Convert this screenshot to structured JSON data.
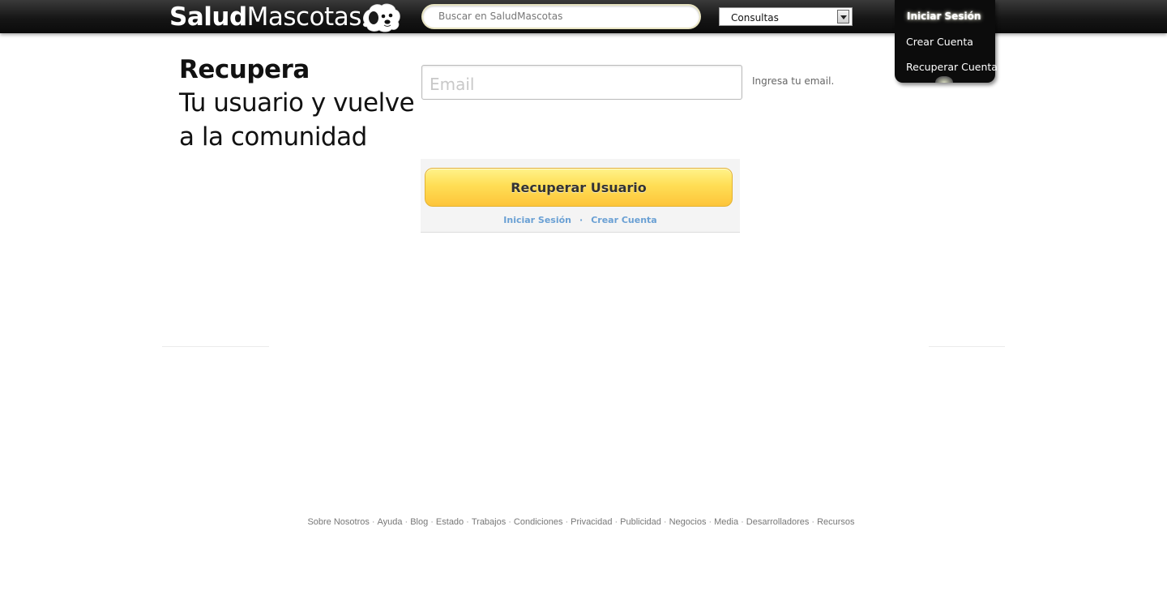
{
  "header": {
    "logo_bold": "Salud",
    "logo_light": "Mascotas",
    "search_placeholder": "Buscar en SaludMascotas",
    "category_select": "Consultas"
  },
  "menu": {
    "items": [
      "Iniciar Sesión",
      "Crear Cuenta",
      "Recuperar Cuenta"
    ],
    "active": "Iniciar Sesión"
  },
  "main": {
    "heading_main": "Recupera",
    "heading_sub_1": "Tu usuario y vuelve",
    "heading_sub_2": "a la comunidad",
    "email_placeholder": "Email",
    "email_hint": "Ingresa tu email.",
    "submit_label": "Recuperar Usuario",
    "link_login": "Iniciar Sesión",
    "link_separator": "·",
    "link_create": "Crear Cuenta"
  },
  "footer": {
    "links": [
      "Sobre Nosotros",
      "Ayuda",
      "Blog",
      "Estado",
      "Trabajos",
      "Condiciones",
      "Privacidad",
      "Publicidad",
      "Negocios",
      "Media",
      "Desarrolladores",
      "Recursos"
    ],
    "separator": "·"
  },
  "colors": {
    "topbar": "#111111",
    "button_yellow": "#ffde55",
    "link_blue": "#6aa0d4"
  }
}
